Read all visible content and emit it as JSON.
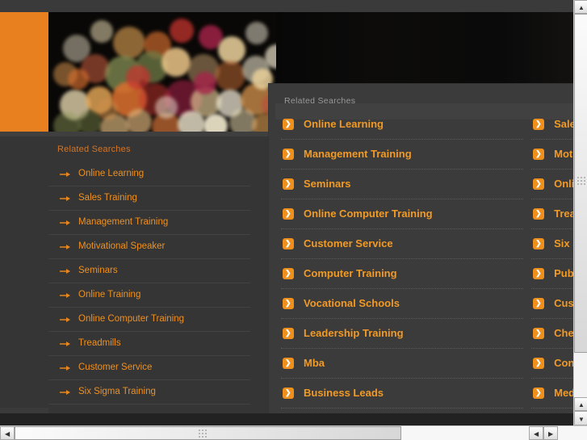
{
  "page": {
    "background_color": "#353535",
    "accent_color": "#e8801f",
    "link_color": "#f29a24"
  },
  "header": {
    "search": {
      "placeholder": "",
      "value": "",
      "icon": "search-icon"
    }
  },
  "sidebar": {
    "title": "Related Searches",
    "items": [
      {
        "label": "Online Learning"
      },
      {
        "label": "Sales Training"
      },
      {
        "label": "Management Training"
      },
      {
        "label": "Motivational Speaker"
      },
      {
        "label": "Seminars"
      },
      {
        "label": "Online Training"
      },
      {
        "label": "Online Computer Training"
      },
      {
        "label": "Treadmills"
      },
      {
        "label": "Customer Service"
      },
      {
        "label": "Six Sigma Training"
      }
    ]
  },
  "overlay": {
    "title": "Related Searches",
    "left_column": [
      {
        "label": "Online Learning"
      },
      {
        "label": "Management Training"
      },
      {
        "label": "Seminars"
      },
      {
        "label": "Online Computer Training"
      },
      {
        "label": "Customer Service"
      },
      {
        "label": "Computer Training"
      },
      {
        "label": "Vocational Schools"
      },
      {
        "label": "Leadership Training"
      },
      {
        "label": "Mba"
      },
      {
        "label": "Business Leads"
      }
    ],
    "right_column": [
      {
        "label": "Sales Training"
      },
      {
        "label": "Motivational Speaker"
      },
      {
        "label": "Online Training"
      },
      {
        "label": "Treadmills"
      },
      {
        "label": "Six Sigma Training"
      },
      {
        "label": "Public Speaking"
      },
      {
        "label": "Customer Service"
      },
      {
        "label": "Chevrolet"
      },
      {
        "label": "Continuing Education"
      },
      {
        "label": "Medical Assistant"
      }
    ]
  },
  "scrollbars": {
    "vertical": {
      "up_arrow": "▲",
      "down_arrow": "▼"
    },
    "horizontal": {
      "left_arrow": "◀",
      "right_arrow": "▶"
    }
  }
}
